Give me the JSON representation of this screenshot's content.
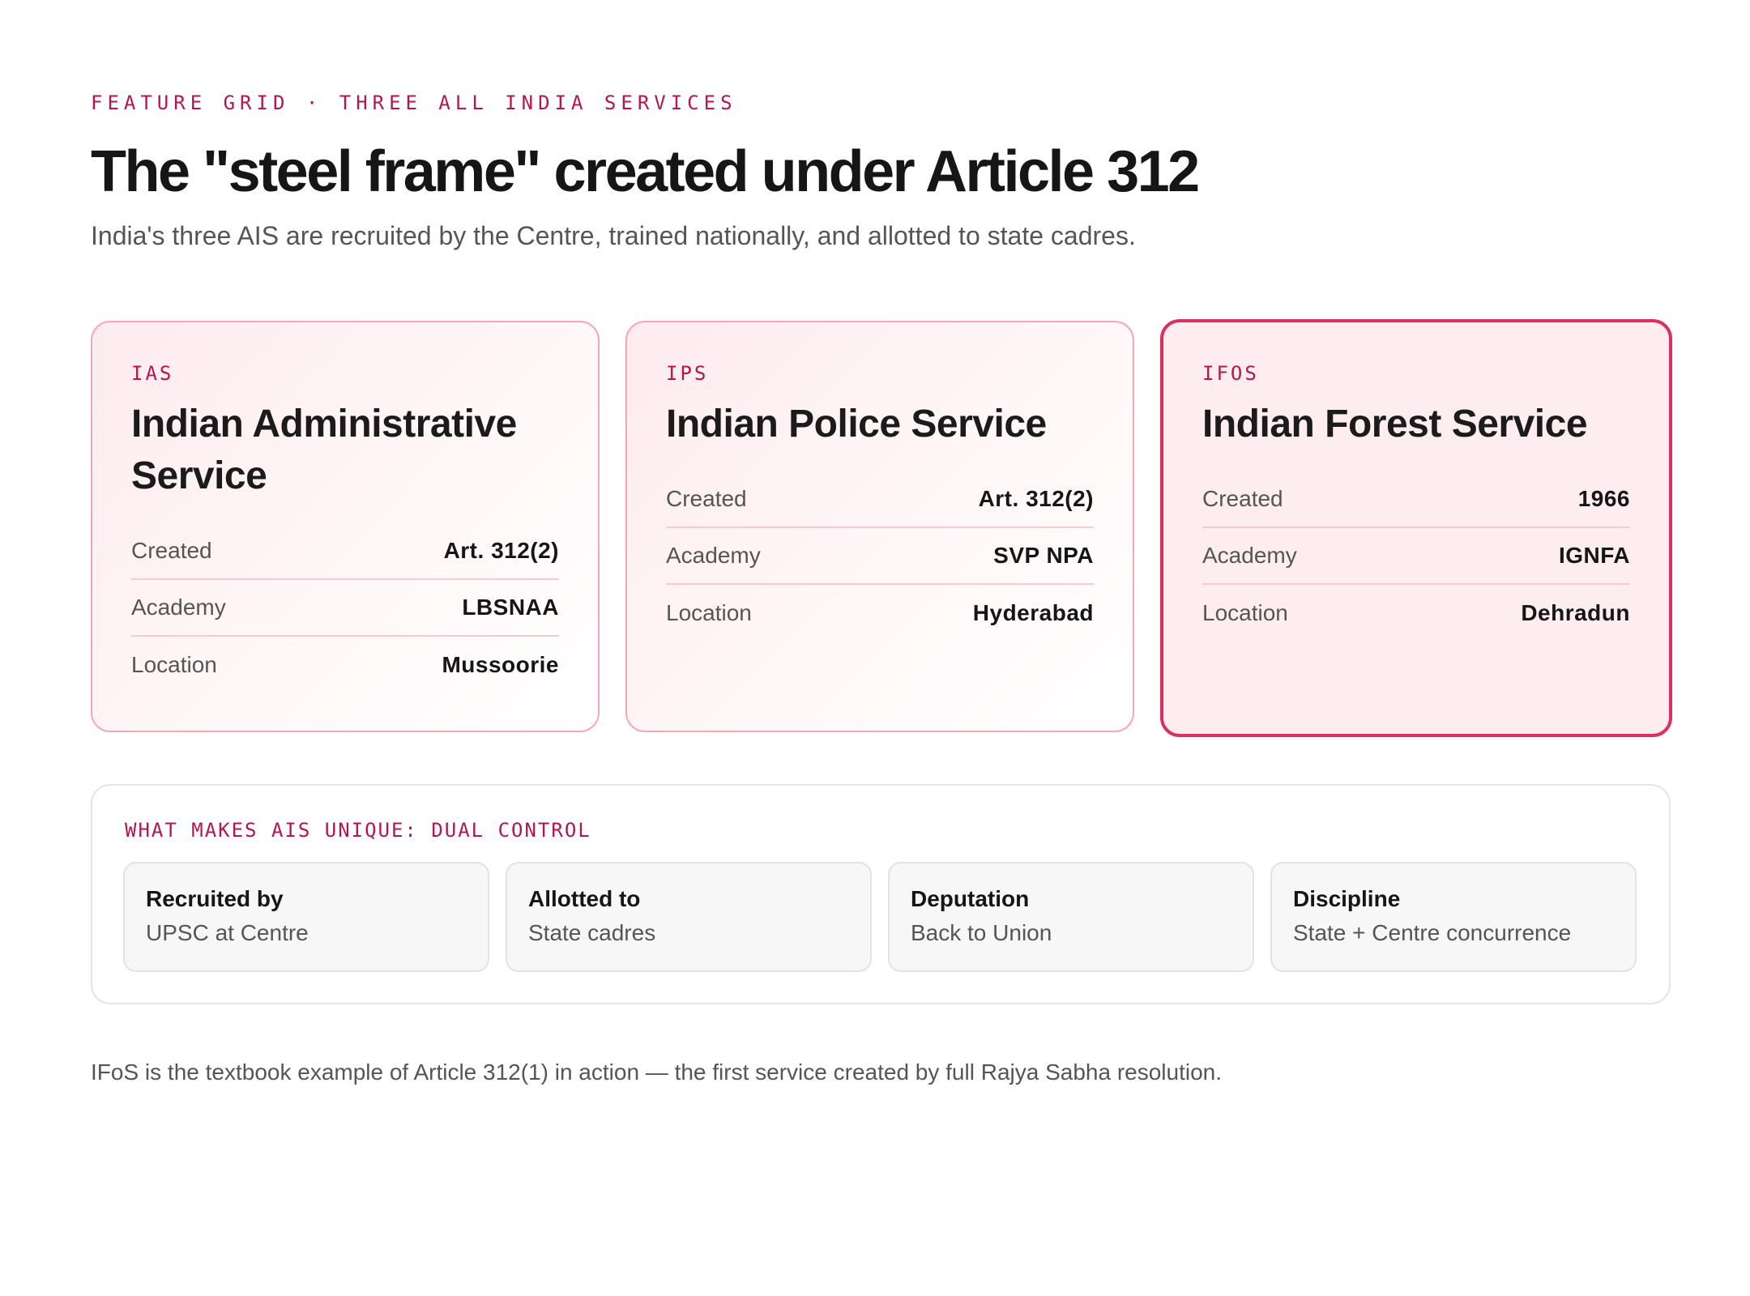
{
  "header": {
    "eyebrow": "FEATURE GRID · THREE ALL INDIA SERVICES",
    "title": "The \"steel frame\" created under Article 312",
    "subtitle": "India's three AIS are recruited by the Centre, trained nationally, and allotted to state cadres."
  },
  "cards": [
    {
      "code": "IAS",
      "name": "Indian Administrative Service",
      "facts": [
        {
          "label": "Created",
          "value": "Art. 312(2)"
        },
        {
          "label": "Academy",
          "value": "LBSNAA"
        },
        {
          "label": "Location",
          "value": "Mussoorie"
        }
      ]
    },
    {
      "code": "IPS",
      "name": "Indian Police Service",
      "facts": [
        {
          "label": "Created",
          "value": "Art. 312(2)"
        },
        {
          "label": "Academy",
          "value": "SVP NPA"
        },
        {
          "label": "Location",
          "value": "Hyderabad"
        }
      ]
    },
    {
      "code": "IFOS",
      "name": "Indian Forest Service",
      "highlighted": true,
      "facts": [
        {
          "label": "Created",
          "value": "1966"
        },
        {
          "label": "Academy",
          "value": "IGNFA"
        },
        {
          "label": "Location",
          "value": "Dehradun"
        }
      ]
    }
  ],
  "dual_control": {
    "title": "WHAT MAKES AIS UNIQUE: DUAL CONTROL",
    "items": [
      {
        "label": "Recruited by",
        "value": "UPSC at Centre"
      },
      {
        "label": "Allotted to",
        "value": "State cadres"
      },
      {
        "label": "Deputation",
        "value": "Back to Union"
      },
      {
        "label": "Discipline",
        "value": "State + Centre concurrence"
      }
    ]
  },
  "footnote": "IFoS is the textbook example of Article 312(1) in action — the first service created by full Rajya Sabha resolution.",
  "colors": {
    "accent": "#b5174b",
    "highlight_border": "#dc2f5e",
    "card_border": "#f3a6bc",
    "card_fill": "#fdedf0"
  }
}
